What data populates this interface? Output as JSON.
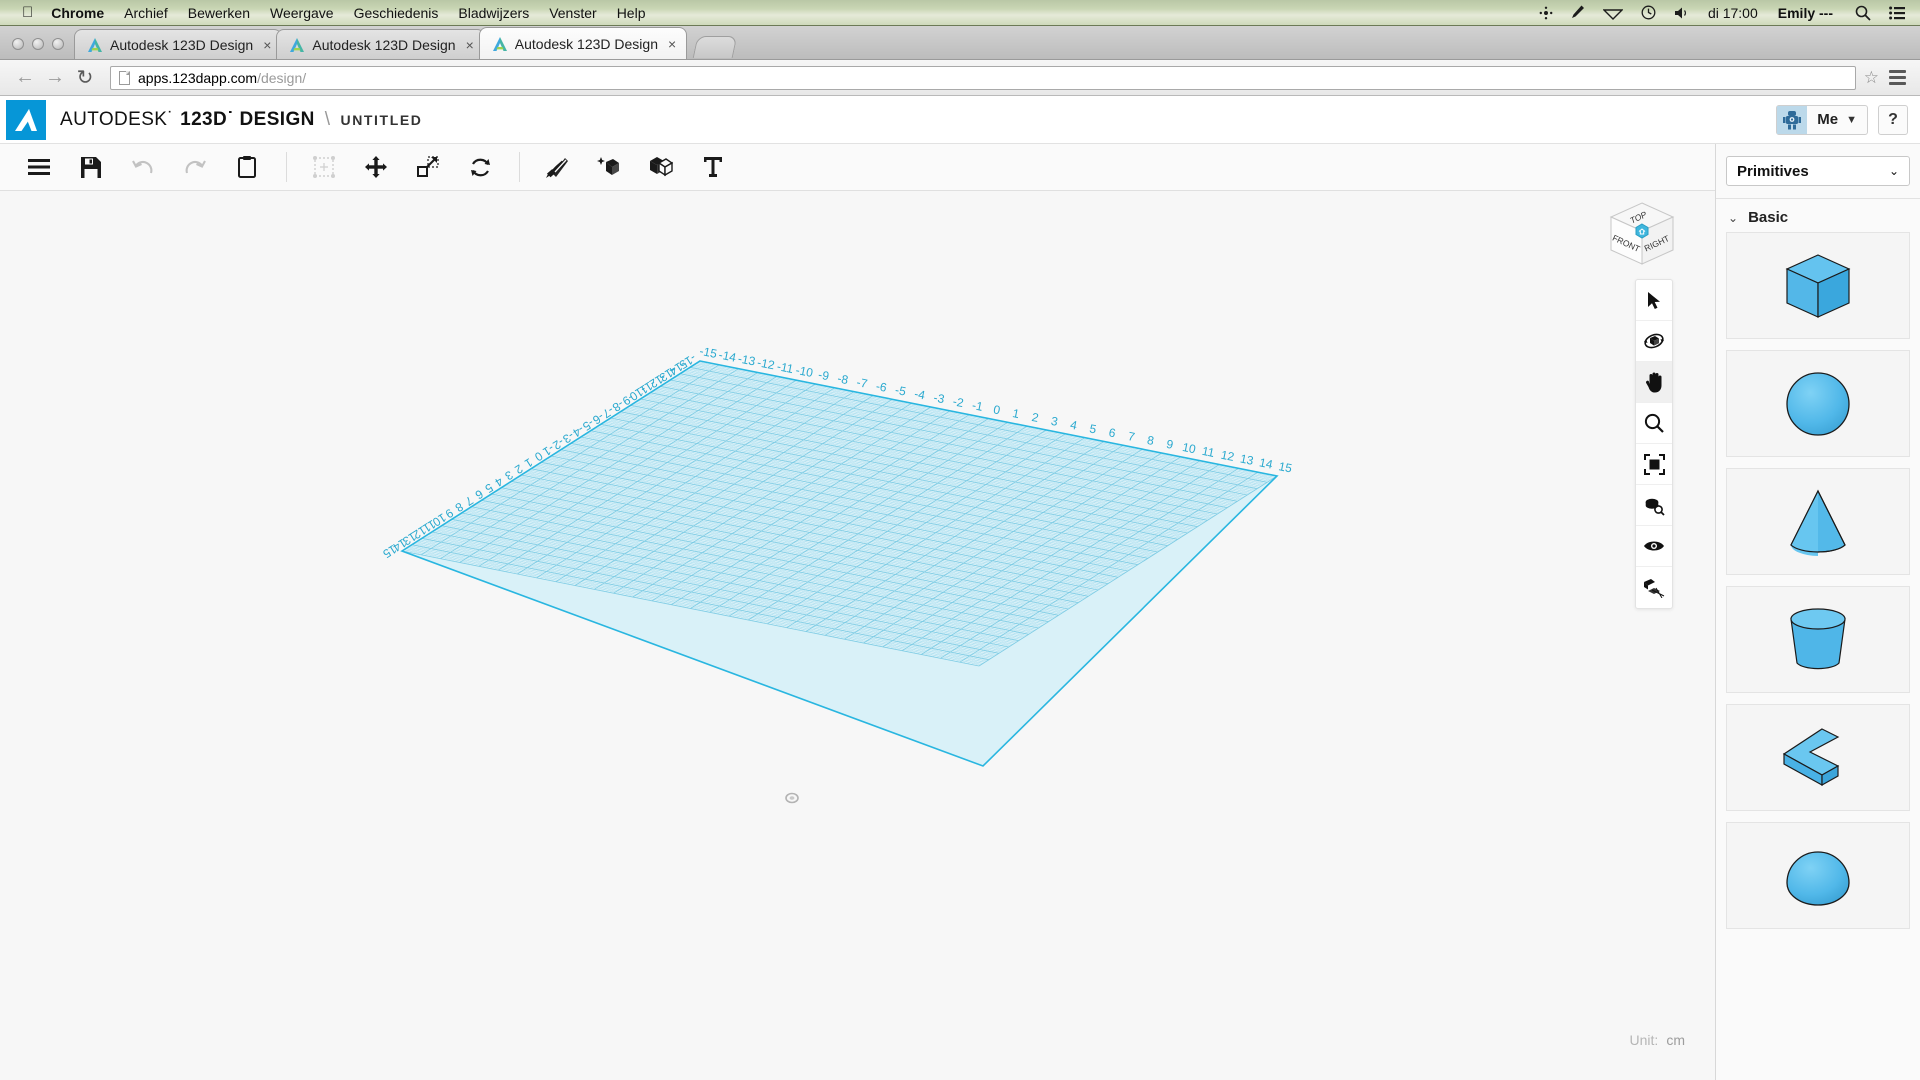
{
  "os_menubar": {
    "apple_icon": "apple-icon",
    "items": [
      {
        "label": "Chrome",
        "bold": true
      },
      {
        "label": "Archief",
        "bold": false
      },
      {
        "label": "Bewerken",
        "bold": false
      },
      {
        "label": "Weergave",
        "bold": false
      },
      {
        "label": "Geschiedenis",
        "bold": false
      },
      {
        "label": "Bladwijzers",
        "bold": false
      },
      {
        "label": "Venster",
        "bold": false
      },
      {
        "label": "Help",
        "bold": false
      }
    ],
    "status_icons": [
      "bluetooth-icon",
      "pen-icon",
      "wifi-icon",
      "clock-icon",
      "volume-icon"
    ],
    "clock": "di 17:00",
    "user": "Emily ---",
    "right_icons": [
      "spotlight-search-icon",
      "notification-center-icon"
    ]
  },
  "browser": {
    "window_buttons": [
      "close-button",
      "minimize-button",
      "zoom-button"
    ],
    "tabs": [
      {
        "title": "Autodesk 123D Design",
        "active": false
      },
      {
        "title": "Autodesk 123D Design",
        "active": false
      },
      {
        "title": "Autodesk 123D Design",
        "active": true
      }
    ],
    "tab_close_glyph": "×",
    "new_tab_label": "+",
    "nav": {
      "back": "←",
      "forward": "→",
      "reload": "↻"
    },
    "url_host": "apps.123dapp.com",
    "url_path": "/design/",
    "bookmark_star": "☆"
  },
  "app": {
    "brand_part1": "AUTODESK˙",
    "brand_part2": "123D˙ DESIGN",
    "separator": "\\",
    "document_title": "UNTITLED",
    "account": {
      "label": "Me",
      "chevron": "▼",
      "avatar": "robot-avatar"
    },
    "help_label": "?"
  },
  "toolbar": {
    "groups": [
      [
        {
          "name": "main-menu-button",
          "icon": "hamburger-icon",
          "enabled": true
        },
        {
          "name": "save-button",
          "icon": "floppy-save-icon",
          "enabled": true
        },
        {
          "name": "undo-button",
          "icon": "undo-arrow-icon",
          "enabled": false
        },
        {
          "name": "redo-button",
          "icon": "redo-arrow-icon",
          "enabled": false
        },
        {
          "name": "paste-button",
          "icon": "clipboard-icon",
          "enabled": true
        }
      ],
      [
        {
          "name": "transform-button",
          "icon": "bounding-box-icon",
          "enabled": false
        },
        {
          "name": "move-button",
          "icon": "move-arrows-icon",
          "enabled": true
        },
        {
          "name": "scale-button",
          "icon": "scale-arrow-icon",
          "enabled": true
        },
        {
          "name": "rotate-button",
          "icon": "rotate-arrows-icon",
          "enabled": true
        }
      ],
      [
        {
          "name": "sketch-button",
          "icon": "pencils-sketch-icon",
          "enabled": true
        },
        {
          "name": "primitives-button",
          "icon": "cube-sparkle-icon",
          "enabled": true
        },
        {
          "name": "combine-button",
          "icon": "two-cubes-icon",
          "enabled": true
        },
        {
          "name": "text-button",
          "icon": "text-t-icon",
          "enabled": true
        }
      ]
    ]
  },
  "viewcube": {
    "top_label": "TOP",
    "front_label": "FRONT",
    "right_label": "RIGHT",
    "home_icon": "home-hexagon-icon"
  },
  "nav_palette": {
    "buttons": [
      {
        "name": "select-tool",
        "icon": "cursor-arrow-icon",
        "active": false
      },
      {
        "name": "orbit-tool",
        "icon": "orbit-icon",
        "active": false
      },
      {
        "name": "pan-tool",
        "icon": "hand-pan-icon",
        "active": true
      },
      {
        "name": "zoom-tool",
        "icon": "magnifier-icon",
        "active": false
      },
      {
        "name": "fit-tool",
        "icon": "zoom-extents-icon",
        "active": false
      },
      {
        "name": "zoom-object-tool",
        "icon": "zoom-object-icon",
        "active": false
      },
      {
        "name": "visibility-tool",
        "icon": "eye-icon",
        "active": false
      },
      {
        "name": "snap-tool",
        "icon": "snap-grid-icon",
        "active": false
      }
    ]
  },
  "right_panel": {
    "category_selected": "Primitives",
    "category_chevron": "⌄",
    "section_label": "Basic",
    "section_chevron": "⌄",
    "shapes": [
      {
        "name": "box-primitive",
        "icon": "cube-shape"
      },
      {
        "name": "sphere-primitive",
        "icon": "sphere-shape"
      },
      {
        "name": "cone-primitive",
        "icon": "cone-shape"
      },
      {
        "name": "cylinder-primitive",
        "icon": "cylinder-shape"
      },
      {
        "name": "wedge-primitive",
        "icon": "lshape-shape"
      },
      {
        "name": "torus-primitive",
        "icon": "dome-shape"
      }
    ]
  },
  "canvas": {
    "unit_label": "Unit:",
    "unit_value": "cm",
    "grid": {
      "min": -15,
      "max": 15,
      "ticks": [
        -15,
        -14,
        -13,
        -12,
        -11,
        -10,
        -9,
        -8,
        -7,
        -6,
        -5,
        -4,
        -3,
        -2,
        -1,
        0,
        1,
        2,
        3,
        4,
        5,
        6,
        7,
        8,
        9,
        10,
        11,
        12,
        13,
        14,
        15
      ],
      "grid_color": "#8fd6ea",
      "fill_color": "#d9f1f8",
      "border_color": "#29b6e0",
      "label_color": "#2aa9cf",
      "origin_marker": "origin-marker"
    }
  }
}
